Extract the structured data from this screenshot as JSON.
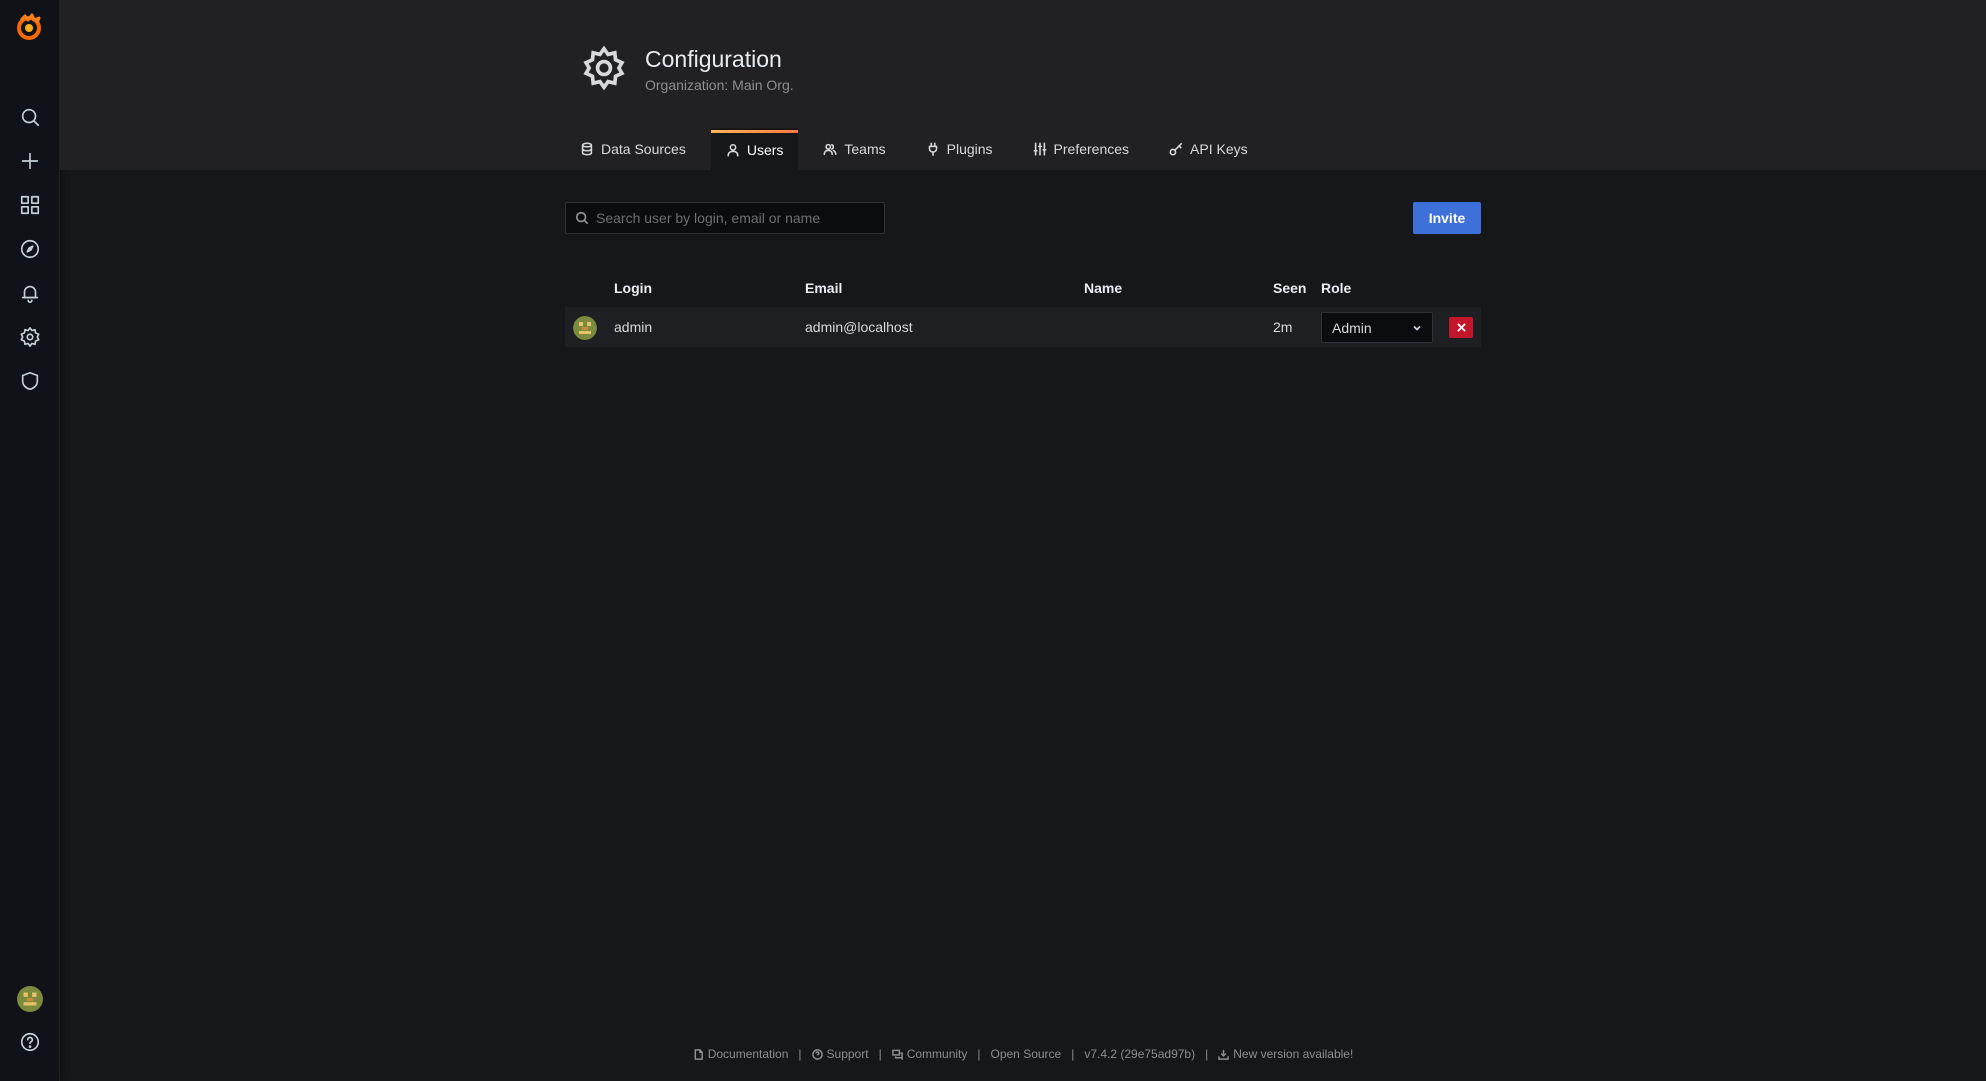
{
  "sidebar": {
    "items": [
      {
        "icon": "search-icon"
      },
      {
        "icon": "plus-icon"
      },
      {
        "icon": "dashboards-icon"
      },
      {
        "icon": "explore-icon"
      },
      {
        "icon": "alerting-bell-icon"
      },
      {
        "icon": "gear-icon"
      },
      {
        "icon": "shield-icon"
      }
    ],
    "bottom": [
      {
        "icon": "user-avatar"
      },
      {
        "icon": "help-icon"
      }
    ]
  },
  "header": {
    "title": "Configuration",
    "subtitle": "Organization: Main Org."
  },
  "tabs": [
    {
      "label": "Data Sources",
      "icon": "database-icon",
      "active": false
    },
    {
      "label": "Users",
      "icon": "user-icon",
      "active": true
    },
    {
      "label": "Teams",
      "icon": "users-icon",
      "active": false
    },
    {
      "label": "Plugins",
      "icon": "plug-icon",
      "active": false
    },
    {
      "label": "Preferences",
      "icon": "sliders-icon",
      "active": false
    },
    {
      "label": "API Keys",
      "icon": "key-icon",
      "active": false
    }
  ],
  "search": {
    "placeholder": "Search user by login, email or name",
    "value": ""
  },
  "invite_label": "Invite",
  "table": {
    "columns": [
      "Login",
      "Email",
      "Name",
      "Seen",
      "Role"
    ],
    "rows": [
      {
        "login": "admin",
        "email": "admin@localhost",
        "name": "",
        "seen": "2m",
        "role": "Admin"
      }
    ]
  },
  "footer": {
    "documentation": "Documentation",
    "support": "Support",
    "community": "Community",
    "open_source": "Open Source",
    "version": "v7.4.2 (29e75ad97b)",
    "new_version": "New version available!",
    "sep": "|"
  },
  "colors": {
    "accent": "#3d71d9",
    "danger": "#c4162a",
    "tab_active_gradient": [
      "#ffb357",
      "#ff7941"
    ]
  }
}
